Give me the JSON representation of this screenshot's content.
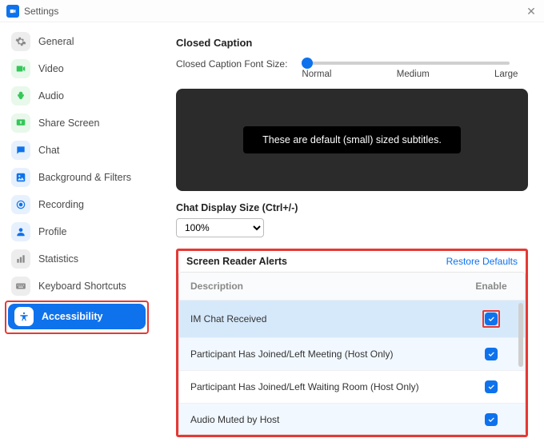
{
  "window": {
    "title": "Settings"
  },
  "sidebar": {
    "items": [
      {
        "label": "General",
        "icon": "gear",
        "bg": "#ededed",
        "fg": "#8a8a8a"
      },
      {
        "label": "Video",
        "icon": "video",
        "bg": "#e8f8ea",
        "fg": "#34c759"
      },
      {
        "label": "Audio",
        "icon": "audio",
        "bg": "#e8f8ea",
        "fg": "#34c759"
      },
      {
        "label": "Share Screen",
        "icon": "share",
        "bg": "#e8f8ea",
        "fg": "#34c759"
      },
      {
        "label": "Chat",
        "icon": "chat",
        "bg": "#e7f1fd",
        "fg": "#0e72ed"
      },
      {
        "label": "Background & Filters",
        "icon": "bg",
        "bg": "#e7f1fd",
        "fg": "#0e72ed"
      },
      {
        "label": "Recording",
        "icon": "rec",
        "bg": "#e7f1fd",
        "fg": "#0e72ed"
      },
      {
        "label": "Profile",
        "icon": "profile",
        "bg": "#e7f1fd",
        "fg": "#0e72ed"
      },
      {
        "label": "Statistics",
        "icon": "stats",
        "bg": "#ededed",
        "fg": "#8a8a8a"
      },
      {
        "label": "Keyboard Shortcuts",
        "icon": "kbd",
        "bg": "#ededed",
        "fg": "#8a8a8a"
      },
      {
        "label": "Accessibility",
        "icon": "access",
        "bg": "#0e72ed",
        "fg": "#ffffff"
      }
    ]
  },
  "closedCaption": {
    "title": "Closed Caption",
    "fontSizeLabel": "Closed Caption Font Size:",
    "ticks": {
      "normal": "Normal",
      "medium": "Medium",
      "large": "Large"
    },
    "previewText": "These are default (small) sized subtitles."
  },
  "chatDisplay": {
    "label": "Chat Display Size (Ctrl+/-)",
    "value": "100%"
  },
  "alerts": {
    "title": "Screen Reader Alerts",
    "restore": "Restore Defaults",
    "columns": {
      "desc": "Description",
      "enable": "Enable"
    },
    "rows": [
      {
        "desc": "IM Chat Received",
        "enabled": true,
        "highlighted": true
      },
      {
        "desc": "Participant Has Joined/Left Meeting (Host Only)",
        "enabled": true
      },
      {
        "desc": "Participant Has Joined/Left Waiting Room (Host Only)",
        "enabled": true
      },
      {
        "desc": "Audio Muted by Host",
        "enabled": true
      }
    ]
  }
}
